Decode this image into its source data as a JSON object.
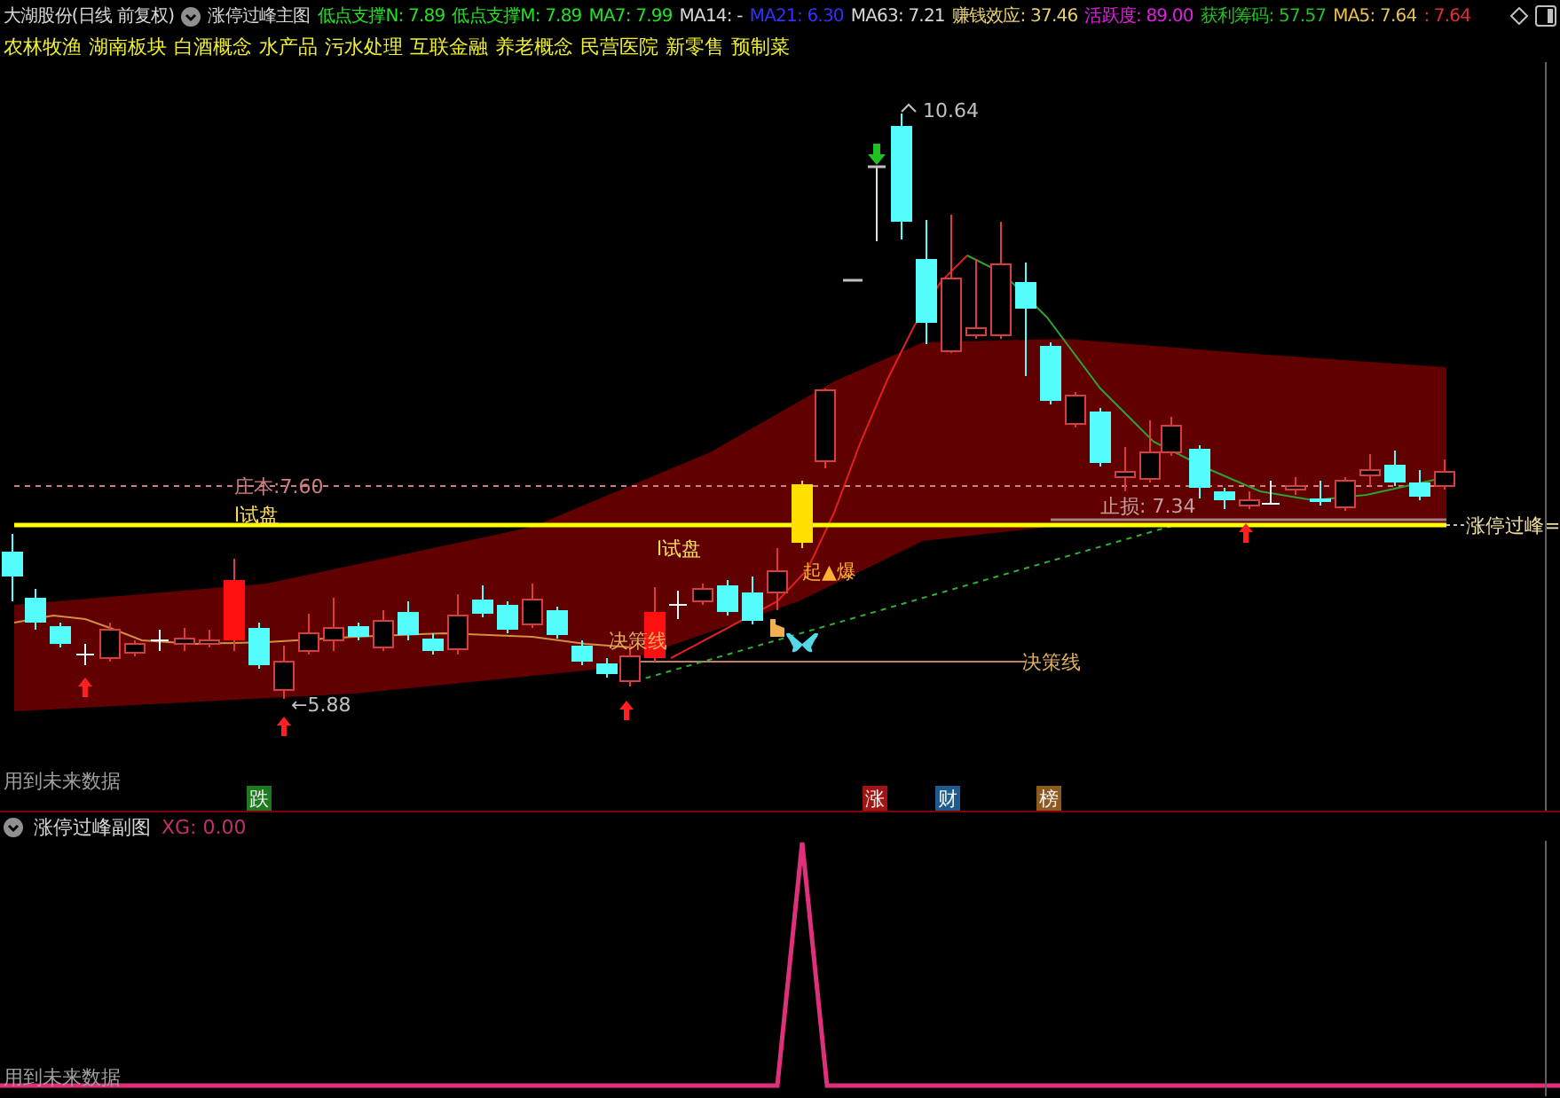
{
  "header": {
    "stock": "大湖股份(日线 前复权)",
    "indicator": "涨停过峰主图",
    "values": [
      {
        "text": "低点支撑N: 7.89",
        "color": "#22e022"
      },
      {
        "text": "低点支撑M: 7.89",
        "color": "#22e022"
      },
      {
        "text": "MA7: 7.99",
        "color": "#22e022"
      },
      {
        "text": "MA14: -",
        "color": "#d8d8d8"
      },
      {
        "text": "MA21: 6.30",
        "color": "#3030ff"
      },
      {
        "text": "MA63: 7.21",
        "color": "#d8d8d8"
      },
      {
        "text": "赚钱效应: 37.46",
        "color": "#e8d070"
      },
      {
        "text": "活跃度: 89.00",
        "color": "#e020e0"
      },
      {
        "text": "获利筹码: 57.57",
        "color": "#22c022"
      },
      {
        "text": "MA5: 7.64",
        "color": "#e8c050"
      },
      {
        "text": ": 7.64",
        "color": "#e03030"
      }
    ]
  },
  "sectors": [
    "农林牧渔",
    "湖南板块",
    "白酒概念",
    "水产品",
    "污水处理",
    "互联金融",
    "养老概念",
    "民营医院",
    "新零售",
    "预制菜"
  ],
  "main_chart": {
    "high_label": "10.64",
    "low_label": "←5.88",
    "cost_line_label": "庄本:7.60",
    "test_labels": [
      "l试盘",
      "l试盘"
    ],
    "decision_labels": [
      "决策线",
      "决策线"
    ],
    "breakout_label": "起▲爆",
    "stop_label": "止损: 7.34",
    "peak_line_label": "涨停过峰=",
    "future_note": "用到未来数据",
    "signal_tags": [
      {
        "text": "跌",
        "color": "#1e7a1e"
      },
      {
        "text": "涨",
        "color": "#a01414"
      },
      {
        "text": "财",
        "color": "#1e5a8c"
      },
      {
        "text": "榜",
        "color": "#8c5a1e"
      }
    ]
  },
  "sub_chart": {
    "title": "涨停过峰副图",
    "reading": "XG: 0.00",
    "future_note": "用到未来数据"
  }
}
